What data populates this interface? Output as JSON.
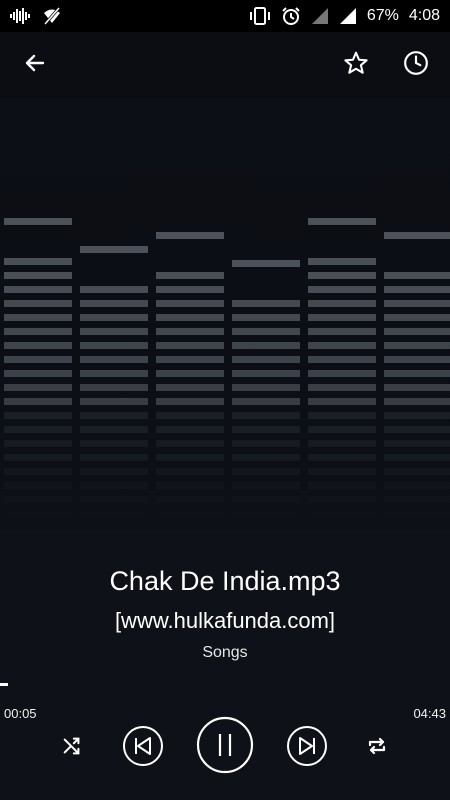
{
  "status_bar": {
    "battery": "67%",
    "time": "4:08",
    "icons": [
      "waveform-icon",
      "wifi-off-icon",
      "vibrate-icon",
      "alarm-icon",
      "signal-icon",
      "signal-full-icon"
    ]
  },
  "top_bar": {
    "back_icon": "arrow-left-icon",
    "favorite_icon": "star-outline-icon",
    "history_icon": "clock-icon"
  },
  "song": {
    "title": "Chak De India.mp3",
    "artist": "[www.hulkafunda.com]",
    "album": "Songs"
  },
  "progress": {
    "elapsed": "00:05",
    "total": "04:43",
    "fraction": 0.018
  },
  "controls": {
    "shuffle_icon": "shuffle-icon",
    "previous_icon": "skip-previous-icon",
    "play_pause_icon": "pause-icon",
    "next_icon": "skip-next-icon",
    "repeat_icon": "repeat-icon"
  },
  "visualizer": {
    "levels": [
      0.72,
      0.62,
      0.68,
      0.55,
      0.72,
      0.68
    ],
    "bar_color": "#5e636a"
  },
  "colors": {
    "background": "#0b0d12",
    "panel": "#0e1218",
    "text": "#ffffff"
  }
}
